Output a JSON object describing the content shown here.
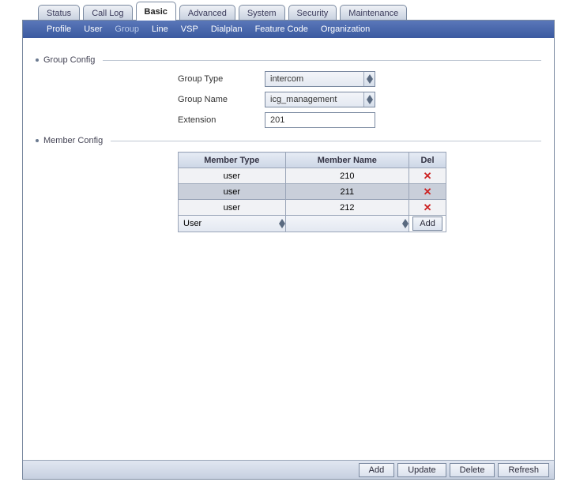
{
  "tabs": {
    "items": [
      {
        "label": "Status"
      },
      {
        "label": "Call Log"
      },
      {
        "label": "Basic"
      },
      {
        "label": "Advanced"
      },
      {
        "label": "System"
      },
      {
        "label": "Security"
      },
      {
        "label": "Maintenance"
      }
    ],
    "active": "Basic"
  },
  "subnav": {
    "items": [
      {
        "label": "Profile"
      },
      {
        "label": "User"
      },
      {
        "label": "Group"
      },
      {
        "label": "Line"
      },
      {
        "label": "VSP"
      },
      {
        "label": "Dialplan"
      },
      {
        "label": "Feature Code"
      },
      {
        "label": "Organization"
      }
    ],
    "active": "Group"
  },
  "sections": {
    "group_config": "Group Config",
    "member_config": "Member Config"
  },
  "group": {
    "type_label": "Group Type",
    "type_value": "intercom",
    "name_label": "Group Name",
    "name_value": "icg_management",
    "ext_label": "Extension",
    "ext_value": "201"
  },
  "member_table": {
    "headers": {
      "type": "Member Type",
      "name": "Member Name",
      "del": "Del"
    },
    "rows": [
      {
        "type": "user",
        "name": "210"
      },
      {
        "type": "user",
        "name": "211"
      },
      {
        "type": "user",
        "name": "212"
      }
    ],
    "addrow": {
      "type_value": "User",
      "name_value": "",
      "add_label": "Add"
    }
  },
  "footer": {
    "add": "Add",
    "update": "Update",
    "delete": "Delete",
    "refresh": "Refresh"
  }
}
